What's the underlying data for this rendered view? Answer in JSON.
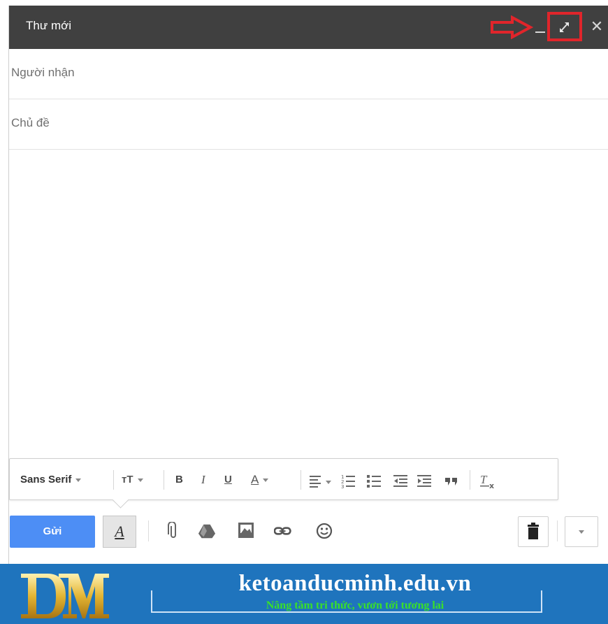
{
  "window": {
    "title": "Thư mới",
    "controls": {
      "minimize_icon": "minimize-icon",
      "maximize_icon": "expand-icon",
      "close_glyph": "✕"
    }
  },
  "compose": {
    "to_placeholder": "Người nhận",
    "subject_placeholder": "Chủ đề",
    "body": ""
  },
  "format_toolbar": {
    "font": "Sans Serif",
    "size_glyph": "тT",
    "bold": "B",
    "italic": "I",
    "underline": "U",
    "text_color": "A",
    "icons": [
      "align-icon",
      "numbered-list-icon",
      "bulleted-list-icon",
      "indent-less-icon",
      "indent-more-icon",
      "quote-icon",
      "remove-formatting-icon"
    ]
  },
  "bottom_toolbar": {
    "send_label": "Gửi",
    "format_toggle": "A",
    "icons": [
      "attach-icon",
      "drive-icon",
      "photo-icon",
      "link-icon",
      "emoji-icon",
      "trash-icon",
      "more-options-icon"
    ]
  },
  "banner": {
    "logo_text": "DM",
    "site": "ketoanducminh.edu.vn",
    "slogan": "Nâng tầm tri thức, vươn tới tương lai"
  },
  "colors": {
    "titlebar": "#404040",
    "send_button": "#4d8ef5",
    "annotation_red": "#e0252b",
    "banner_blue": "#1f74bd",
    "slogan_green": "#39e02a"
  }
}
